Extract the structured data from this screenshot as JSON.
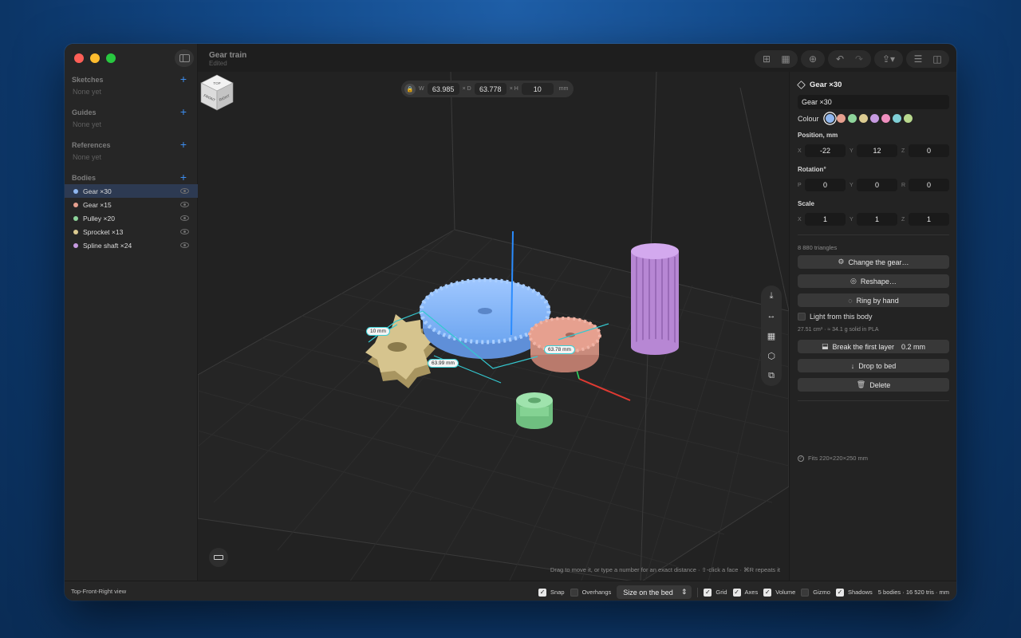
{
  "document": {
    "title": "Gear train",
    "subtitle": "Edited"
  },
  "sidebar": {
    "sections": [
      {
        "title": "Sketches",
        "empty": "None yet"
      },
      {
        "title": "Guides",
        "empty": "None yet"
      },
      {
        "title": "References",
        "empty": "None yet"
      }
    ],
    "bodies_title": "Bodies",
    "add_symbol": "+",
    "bodies": [
      {
        "label": "Gear ×30",
        "color": "#8fb6ee",
        "selected": true
      },
      {
        "label": "Gear ×15",
        "color": "#e6a08f"
      },
      {
        "label": "Pulley ×20",
        "color": "#8ed49b"
      },
      {
        "label": "Sprocket ×13",
        "color": "#dccb91"
      },
      {
        "label": "Spline shaft ×24",
        "color": "#c69ae0"
      }
    ]
  },
  "toolbar": {
    "icons": [
      "add-body-icon",
      "grid-view-icon",
      "target-icon",
      "undo-icon",
      "redo-icon",
      "share-icon",
      "list-icon",
      "inspector-toggle-icon"
    ]
  },
  "dimensions": {
    "w_label": "W",
    "w_value": "63.985",
    "d_label": "× D",
    "d_value": "63.778",
    "h_label": "× H",
    "h_value": "10",
    "unit": "mm"
  },
  "view_cube": {
    "top": "TOP",
    "front": "FRONT",
    "right": "RIGHT"
  },
  "viewport": {
    "tags": {
      "height": "10 mm",
      "width": "63.99 mm",
      "depth": "63.78 mm"
    },
    "hint": "Drag to move it, or type a number for an exact distance  ·  ⇧-click a face  ·  ⌘R repeats it"
  },
  "inspector": {
    "title": "Gear ×30",
    "name_value": "Gear ×30",
    "colour_label": "Colour",
    "colours": [
      "#8fb6ee",
      "#e6a08f",
      "#8ed49b",
      "#dccb91",
      "#c69ae0",
      "#ef8fbf",
      "#7fcfd6",
      "#b9d98e"
    ],
    "position": {
      "label": "Position, mm",
      "x": "-22",
      "y": "12",
      "z": "0"
    },
    "rotation": {
      "label": "Rotation°",
      "p": "0",
      "y": "0",
      "r": "0"
    },
    "scale": {
      "label": "Scale",
      "x": "1",
      "y": "1",
      "z": "1"
    },
    "axis_labels": {
      "x": "X",
      "y": "Y",
      "z": "Z",
      "p": "P",
      "r": "R"
    },
    "triangles": "8 880 triangles",
    "actions": {
      "change_gear": "Change the gear…",
      "reshape": "Reshape…",
      "ring": "Ring by hand",
      "light": "Light from this body",
      "volume_note": "27.51 cm³ · ≈ 34.1 g solid in PLA",
      "break_layer": "Break the first layer",
      "break_value": "0.2 mm",
      "drop": "Drop to bed",
      "delete": "Delete"
    },
    "fits": "Fits 220×220×250 mm"
  },
  "statusbar": {
    "view": "Top-Front-Right view",
    "snap": "Snap",
    "overhangs": "Overhangs",
    "size_select": "Size on the bed",
    "grid": "Grid",
    "axes": "Axes",
    "volume": "Volume",
    "gizmo": "Gizmo",
    "shadows": "Shadows",
    "summary": "5 bodies · 16 520 tris · mm"
  }
}
